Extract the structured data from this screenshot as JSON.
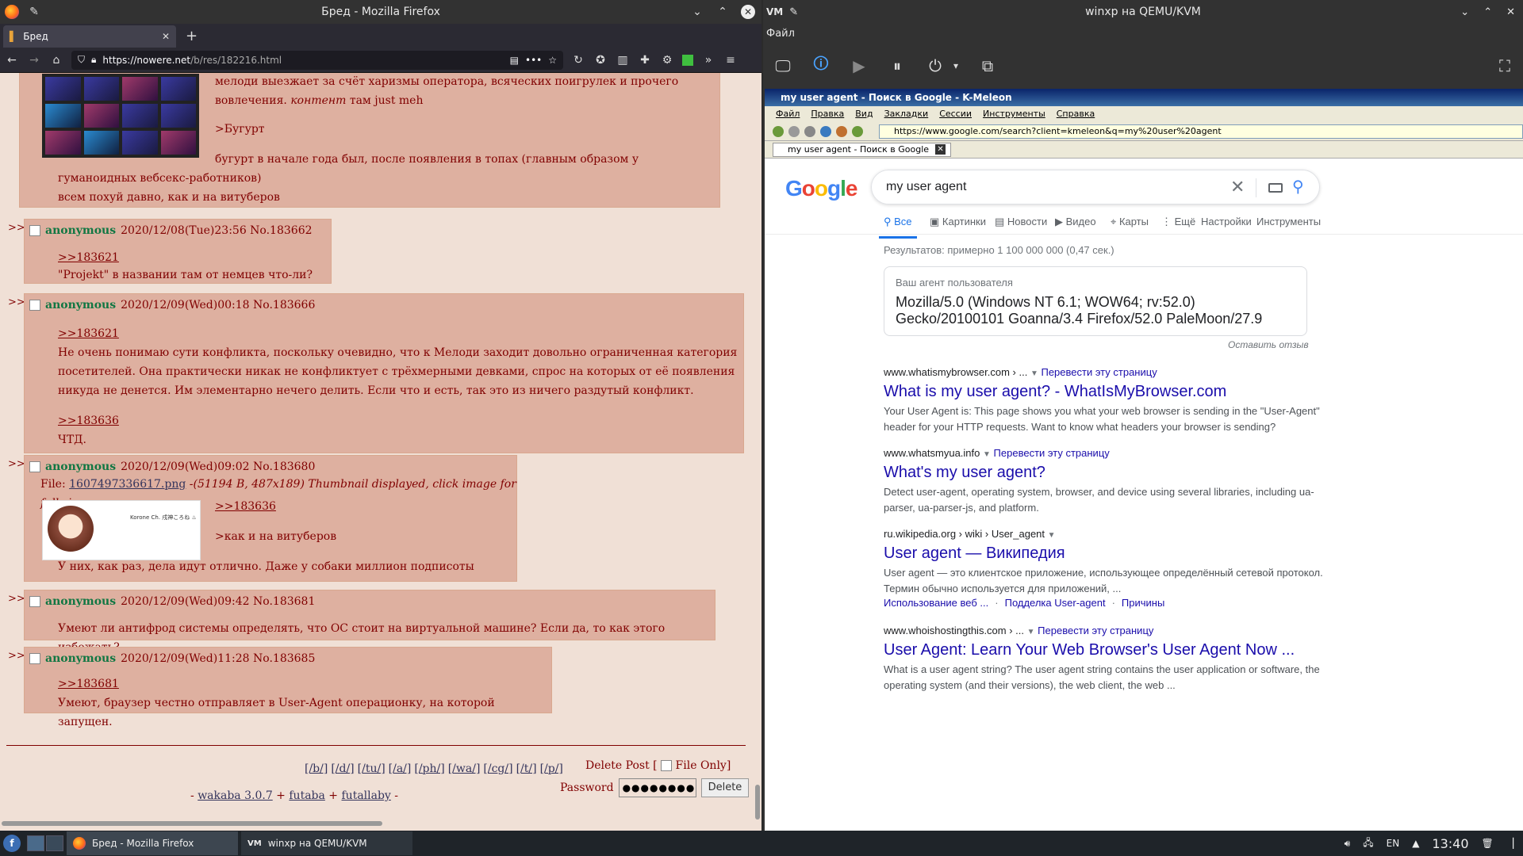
{
  "firefox": {
    "window_title": "Бред - Mozilla Firefox",
    "tab_title": "Бред",
    "url_host": "https://nowere.net",
    "url_path": "/b/res/182216.html"
  },
  "thread": {
    "op_tail": {
      "line1": "мелоди выезжает за счёт харизмы оператора, всяческих поигрулек и прочего",
      "line2_a": "вовлечения. ",
      "line2_em": "контент",
      "line2_b": " там just meh",
      "green": ">Бугурт",
      "line3": "бугурт в начале года был, после появления в топах (главным образом у",
      "line4": "гуманоидных вебсекс-работников)",
      "line5": "всем похуй давно, как и на витуберов"
    },
    "posts": [
      {
        "name": "anonymous",
        "meta": "2020/12/08(Tue)23:56 No.183662",
        "quote1": ">>183621",
        "text1": "\"Projekt\" в названии там от немцев что-ли?"
      },
      {
        "name": "anonymous",
        "meta": "2020/12/09(Wed)00:18 No.183666",
        "quote1": ">>183621",
        "text1": "Не очень понимаю сути конфликта, поскольку очевидно, что к Мелоди заходит довольно ограниченная категория",
        "text2": "посетителей. Она практически никак не конфликтует с трёхмерными девками, спрос на которых от её появления",
        "text3": "никуда не денется. Им элементарно нечего делить. Если что и есть, так это из ничего раздутый конфликт.",
        "quote2": ">>183636",
        "text4": "ЧТД."
      },
      {
        "name": "anonymous",
        "meta": "2020/12/09(Wed)09:02 No.183680",
        "file_label": "File: ",
        "file_name": "1607497336617.png",
        "file_info": " -(51194 B, 487x189) Thumbnail displayed, click image for full size.",
        "quote1": ">>183636",
        "green": ">как и на витуберов",
        "text1": "У них, как раз, дела идут отлично. Даже у собаки миллион подписоты"
      },
      {
        "name": "anonymous",
        "meta": "2020/12/09(Wed)09:42 No.183681",
        "text1": "Умеют ли антифрод системы определять, что ОС стоит на виртуальной машине? Если да, то как этого избежать?"
      },
      {
        "name": "anonymous",
        "meta": "2020/12/09(Wed)11:28 No.183685",
        "quote1": ">>183681",
        "text1": "Умеют, браузер честно отправляет в User-Agent операционку, на которой запущен."
      }
    ],
    "arrows": ">>",
    "thumb_caption": "Korone Ch. 戌神ころね ♨",
    "board_links": [
      "[/b/]",
      "[/d/]",
      "[/tu/]",
      "[/a/]",
      "[/ph/]",
      "[/wa/]",
      "[/cg/]",
      "[/t/]",
      "[/p/]"
    ],
    "delete_post_label": "Delete Post [",
    "file_only_label": "File Only]",
    "password_label": "Password",
    "password_value": "●●●●●●●●",
    "delete_button": "Delete",
    "credits_prefix": "- ",
    "credits_wakaba": "wakaba 3.0.7",
    "credits_plus1": " + ",
    "credits_futaba": "futaba",
    "credits_plus2": " + ",
    "credits_futallaby": "futallaby",
    "credits_suffix": " -"
  },
  "vm": {
    "window_title": "winxp на QEMU/KVM",
    "menu_file": "Файл"
  },
  "kmeleon": {
    "title": "my user agent - Поиск в Google - K-Meleon",
    "menu": [
      "Файл",
      "Правка",
      "Вид",
      "Закладки",
      "Сессии",
      "Инструменты",
      "Справка"
    ],
    "url": "https://www.google.com/search?client=kmeleon&q=my%20user%20agent",
    "tab": "my user agent - Поиск в Google"
  },
  "google": {
    "query": "my user agent",
    "tabs": [
      "Все",
      "Картинки",
      "Новости",
      "Видео",
      "Карты",
      "Ещё",
      "Настройки",
      "Инструменты"
    ],
    "results_count": "Результатов: примерно 1 100 000 000 (0,47 сек.)",
    "ua_label": "Ваш агент пользователя",
    "ua_value": "Mozilla/5.0 (Windows NT 6.1; WOW64; rv:52.0) Gecko/20100101 Goanna/3.4 Firefox/52.0 PaleMoon/27.9",
    "feedback": "Оставить отзыв",
    "results": [
      {
        "cite": "www.whatismybrowser.com › ...",
        "translate": "Перевести эту страницу",
        "title": "What is my user agent? - WhatIsMyBrowser.com",
        "snippet": "Your User Agent is: This page shows you what your web browser is sending in the \"User-Agent\" header for your HTTP requests. Want to know what headers your browser is sending?"
      },
      {
        "cite": "www.whatsmyua.info",
        "translate": "Перевести эту страницу",
        "title": "What's my user agent?",
        "snippet": "Detect user-agent, operating system, browser, and device using several libraries, including ua-parser, ua-parser-js, and platform."
      },
      {
        "cite": "ru.wikipedia.org › wiki › User_agent",
        "translate": "",
        "title": "User agent — Википедия",
        "snippet": "User agent — это клиентское приложение, использующее определённый сетевой протокол. Термин обычно используется для приложений, ...",
        "sub1": "Использование веб ...",
        "sub2": "Подделка User-agent",
        "sub3": "Причины"
      },
      {
        "cite": "www.whoishostingthis.com › ...",
        "translate": "Перевести эту страницу",
        "title": "User Agent: Learn Your Web Browser's User Agent Now ...",
        "snippet": "What is a user agent string? The user agent string contains the user application or software, the operating system (and their versions), the web client, the web ..."
      }
    ]
  },
  "taskbar": {
    "task1": "Бред - Mozilla Firefox",
    "task2": "winxp на QEMU/KVM",
    "lang": "EN",
    "clock": "13:40"
  },
  "colors": {
    "board_bg": "#f0e0d6",
    "reply_bg": "#deb0a0",
    "name_green": "#117743",
    "greentext": "#789922",
    "google_link": "#1a0dab"
  }
}
